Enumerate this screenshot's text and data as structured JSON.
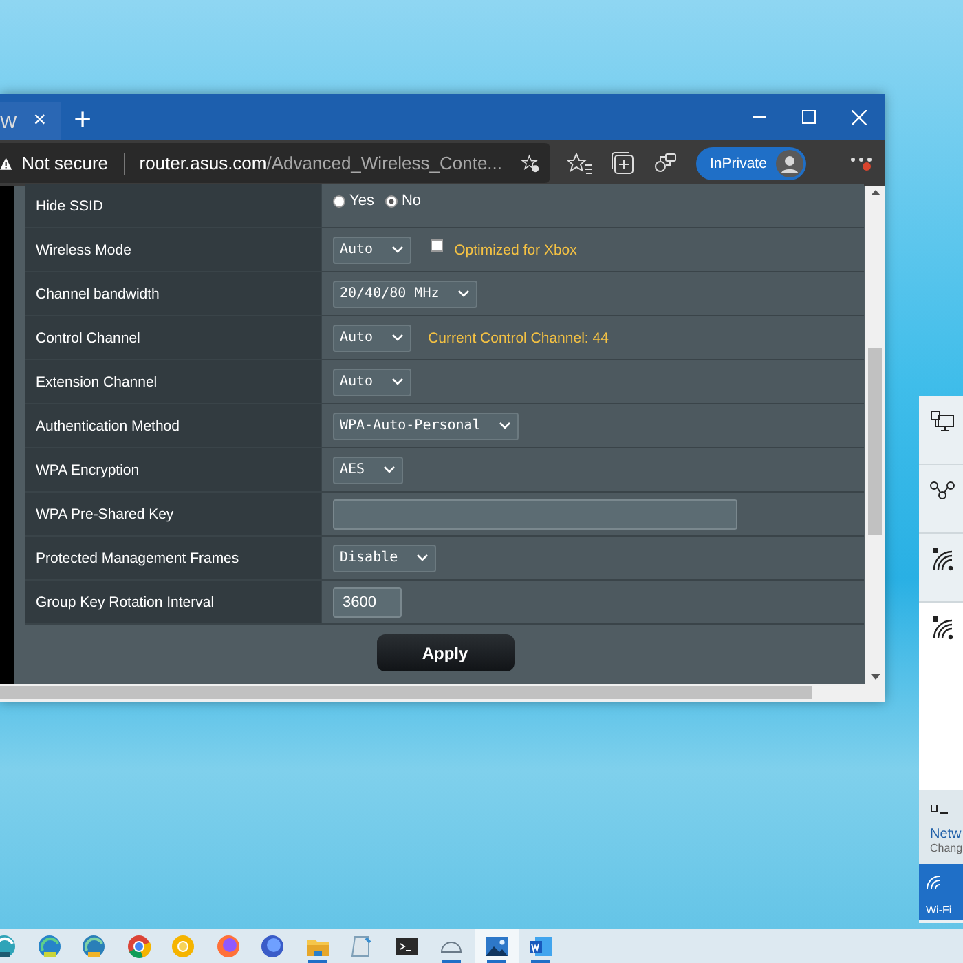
{
  "browser": {
    "tab": {
      "label": "W",
      "close": "×"
    },
    "new_tab": "+",
    "address_bar": {
      "security": "Not secure",
      "host": "router.asus.com",
      "path": "/Advanced_Wireless_Conte..."
    },
    "profile": {
      "label": "InPrivate"
    },
    "settings": [
      {
        "kind": "radio",
        "label": "Hide SSID",
        "options": [
          {
            "label": "Yes",
            "selected": false
          },
          {
            "label": "No",
            "selected": true
          }
        ]
      },
      {
        "kind": "select",
        "label": "Wireless Mode",
        "value": "Auto",
        "checkbox": {
          "label": "Optimized for Xbox",
          "checked": false
        }
      },
      {
        "kind": "select",
        "label": "Channel bandwidth",
        "value": "20/40/80 MHz"
      },
      {
        "kind": "select",
        "label": "Control Channel",
        "value": "Auto",
        "note": "Current Control Channel: 44"
      },
      {
        "kind": "select",
        "label": "Extension Channel",
        "value": "Auto"
      },
      {
        "kind": "select",
        "label": "Authentication Method",
        "value": "WPA-Auto-Personal"
      },
      {
        "kind": "select",
        "label": "WPA Encryption",
        "value": "AES"
      },
      {
        "kind": "input",
        "label": "WPA Pre-Shared Key"
      },
      {
        "kind": "select",
        "label": "Protected Management Frames",
        "value": "Disable"
      },
      {
        "kind": "input",
        "label": "Group Key Rotation Interval",
        "value": "3600"
      }
    ],
    "apply": "Apply"
  },
  "network_flyout": {
    "networks": [
      {
        "kind": "ethernet",
        "selected": false
      },
      {
        "kind": "hub",
        "selected": false
      },
      {
        "kind": "wifi",
        "selected": false
      },
      {
        "kind": "wifi",
        "selected": true
      }
    ],
    "settings_title": "Netw",
    "settings_subtitle": "Chang",
    "wifi_tile": {
      "label": "Wi-Fi",
      "on": true
    }
  },
  "taskbar": {
    "apps": [
      {
        "kind": "edgebeta",
        "running": false,
        "active": false
      },
      {
        "kind": "edgedev",
        "running": false,
        "active": false
      },
      {
        "kind": "edgecanary",
        "running": false,
        "active": false
      },
      {
        "kind": "chrome",
        "running": false,
        "active": false
      },
      {
        "kind": "canary",
        "running": false,
        "active": false
      },
      {
        "kind": "firefox",
        "running": false,
        "active": false
      },
      {
        "kind": "nightly",
        "running": false,
        "active": false
      },
      {
        "kind": "folder",
        "running": true,
        "active": false
      },
      {
        "kind": "notepad",
        "running": false,
        "active": false
      },
      {
        "kind": "terminal",
        "running": false,
        "active": false
      },
      {
        "kind": "arc",
        "running": true,
        "active": false
      },
      {
        "kind": "photos",
        "running": true,
        "active": true
      },
      {
        "kind": "word",
        "running": true,
        "active": false
      }
    ]
  }
}
